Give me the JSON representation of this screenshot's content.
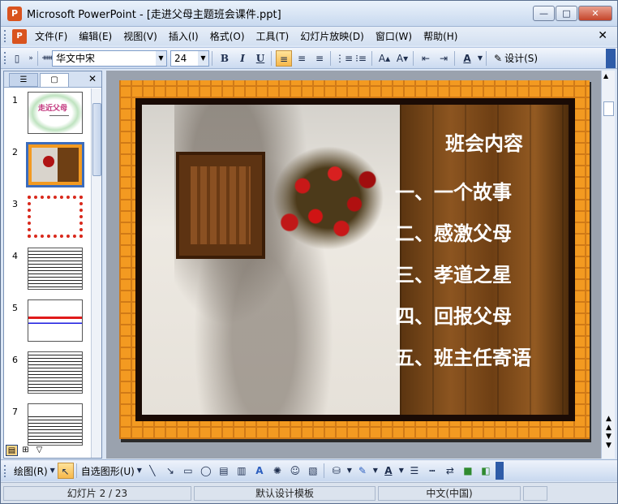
{
  "app": {
    "title": "Microsoft PowerPoint - [走进父母主题班会课件.ppt]",
    "icon_label": "P"
  },
  "window_buttons": {
    "minimize": "—",
    "maximize": "□",
    "close": "✕"
  },
  "menu": {
    "items": [
      "文件(F)",
      "编辑(E)",
      "视图(V)",
      "插入(I)",
      "格式(O)",
      "工具(T)",
      "幻灯片放映(D)",
      "窗口(W)",
      "帮助(H)"
    ],
    "close": "✕"
  },
  "toolbar": {
    "font_name": "华文中宋",
    "font_size": "24",
    "bold": "B",
    "italic": "I",
    "underline": "U",
    "design_label": "设计(S)"
  },
  "left_pane": {
    "tab_outline": "☰",
    "tab_slides": "▢",
    "close": "✕",
    "slides": [
      {
        "num": "1",
        "caption": "走近父母"
      },
      {
        "num": "2",
        "caption": ""
      },
      {
        "num": "3",
        "caption": ""
      },
      {
        "num": "4",
        "caption": ""
      },
      {
        "num": "5",
        "caption": ""
      },
      {
        "num": "6",
        "caption": ""
      },
      {
        "num": "7",
        "caption": ""
      }
    ],
    "selected_slide": 2
  },
  "slide": {
    "title": "班会内容",
    "items": [
      "一、一个故事",
      "二、感激父母",
      "三、孝道之星",
      "四、回报父母",
      "五、班主任寄语"
    ]
  },
  "drawbar": {
    "draw_label": "绘图(R)",
    "autoshape_label": "自选图形(U)"
  },
  "status": {
    "slide_info": "幻灯片 2 / 23",
    "template": "默认设计模板",
    "language": "中文(中国)"
  },
  "colors": {
    "frame_orange": "#f39a21",
    "title_bar": "#c8d9ef",
    "accent_blue": "#3c6cbc"
  }
}
